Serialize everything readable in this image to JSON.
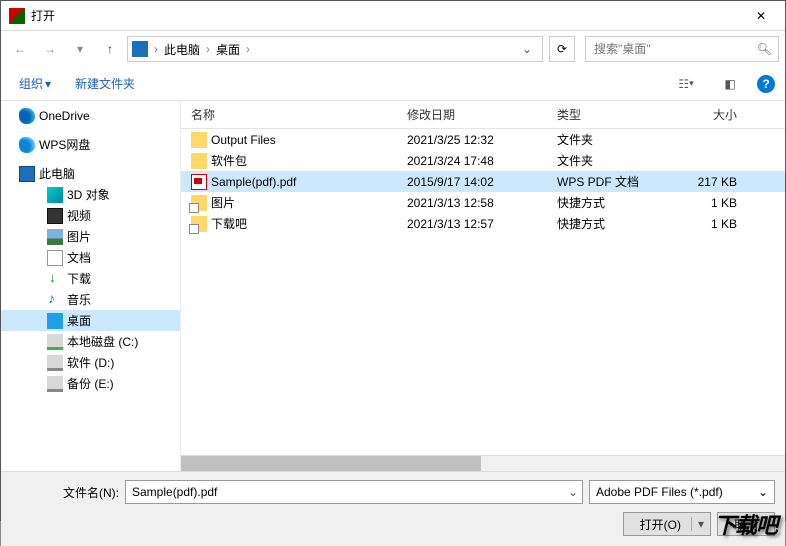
{
  "title": "打开",
  "breadcrumb": {
    "root": "此电脑",
    "current": "桌面"
  },
  "search_placeholder": "搜索\"桌面\"",
  "toolbar": {
    "organize": "组织",
    "new_folder": "新建文件夹"
  },
  "sidebar": {
    "onedrive": "OneDrive",
    "wps": "WPS网盘",
    "this_pc": "此电脑",
    "objects3d": "3D 对象",
    "videos": "视频",
    "pictures": "图片",
    "documents": "文档",
    "downloads": "下载",
    "music": "音乐",
    "desktop": "桌面",
    "disk_c": "本地磁盘 (C:)",
    "disk_d": "软件 (D:)",
    "disk_e": "备份 (E:)"
  },
  "columns": {
    "name": "名称",
    "date": "修改日期",
    "type": "类型",
    "size": "大小"
  },
  "files": [
    {
      "name": "Output Files",
      "date": "2021/3/25 12:32",
      "type": "文件夹",
      "size": ""
    },
    {
      "name": "软件包",
      "date": "2021/3/24 17:48",
      "type": "文件夹",
      "size": ""
    },
    {
      "name": "Sample(pdf).pdf",
      "date": "2015/9/17 14:02",
      "type": "WPS PDF 文档",
      "size": "217 KB"
    },
    {
      "name": "图片",
      "date": "2021/3/13 12:58",
      "type": "快捷方式",
      "size": "1 KB"
    },
    {
      "name": "下载吧",
      "date": "2021/3/13 12:57",
      "type": "快捷方式",
      "size": "1 KB"
    }
  ],
  "filename_label": "文件名(N):",
  "filename_value": "Sample(pdf).pdf",
  "filter_value": "Adobe PDF Files (*.pdf)",
  "open_btn": "打开(O)",
  "cancel_btn": "取消",
  "watermark": "下载吧"
}
